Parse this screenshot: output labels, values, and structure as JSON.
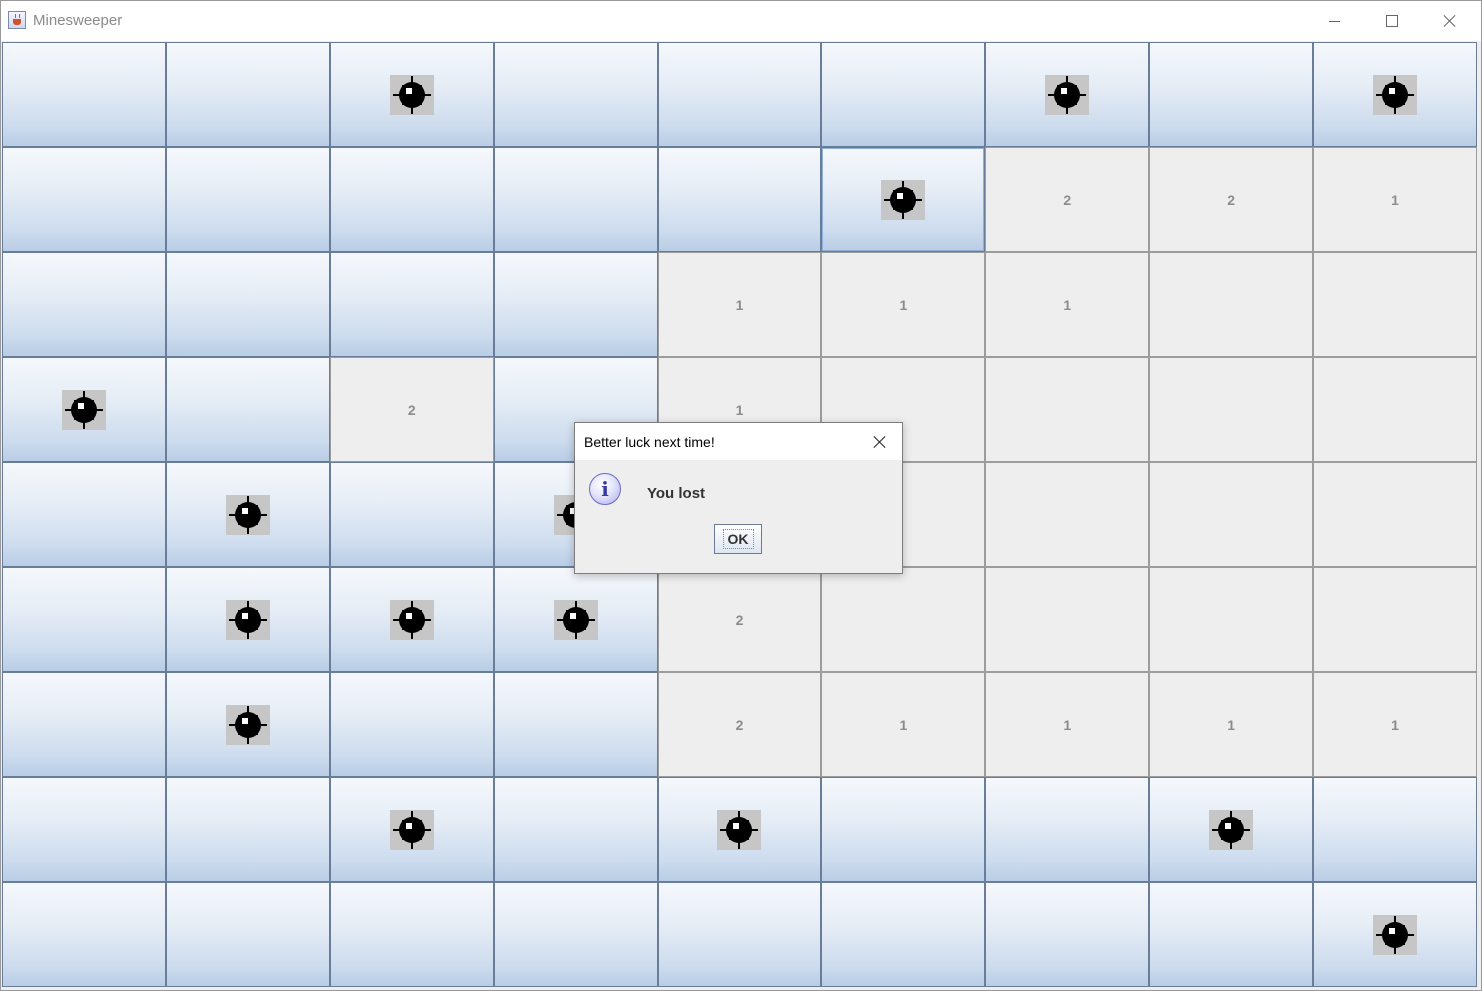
{
  "window": {
    "title": "Minesweeper",
    "app_icon": "java-cup-icon",
    "controls": {
      "minimize": "minimize-icon",
      "maximize": "maximize-icon",
      "close": "close-icon"
    }
  },
  "board": {
    "rows": 9,
    "columns": 9,
    "legend": "C = covered, M = mine, digit = revealed number, . = revealed empty",
    "grid": [
      [
        "C",
        "C",
        "M",
        "C",
        "C",
        "C",
        "M",
        "C",
        "M"
      ],
      [
        "C",
        "C",
        "C",
        "C",
        "C",
        "M",
        "2",
        "2",
        "1"
      ],
      [
        "C",
        "C",
        "C",
        "C",
        "1",
        "1",
        "1",
        ".",
        "."
      ],
      [
        "M",
        "C",
        "2",
        "C",
        "1",
        ".",
        ".",
        ".",
        "."
      ],
      [
        "C",
        "M",
        "C",
        "M",
        ".",
        ".",
        ".",
        ".",
        "."
      ],
      [
        "C",
        "M",
        "M",
        "M",
        "2",
        ".",
        ".",
        ".",
        "."
      ],
      [
        "C",
        "M",
        "C",
        "C",
        "2",
        "1",
        "1",
        "1",
        "1"
      ],
      [
        "C",
        "C",
        "M",
        "C",
        "M",
        "C",
        "C",
        "M",
        "C"
      ],
      [
        "C",
        "C",
        "C",
        "C",
        "C",
        "C",
        "C",
        "C",
        "M"
      ]
    ],
    "focused_cell": [
      1,
      5
    ],
    "colors": {
      "covered_top": "#f5f8fc",
      "covered_bottom": "#b9cde6",
      "revealed": "#eeeeee",
      "number": "#8c8c8c"
    }
  },
  "dialog": {
    "title": "Better luck next time!",
    "icon": "info-icon",
    "message": "You lost",
    "ok_label": "OK"
  }
}
